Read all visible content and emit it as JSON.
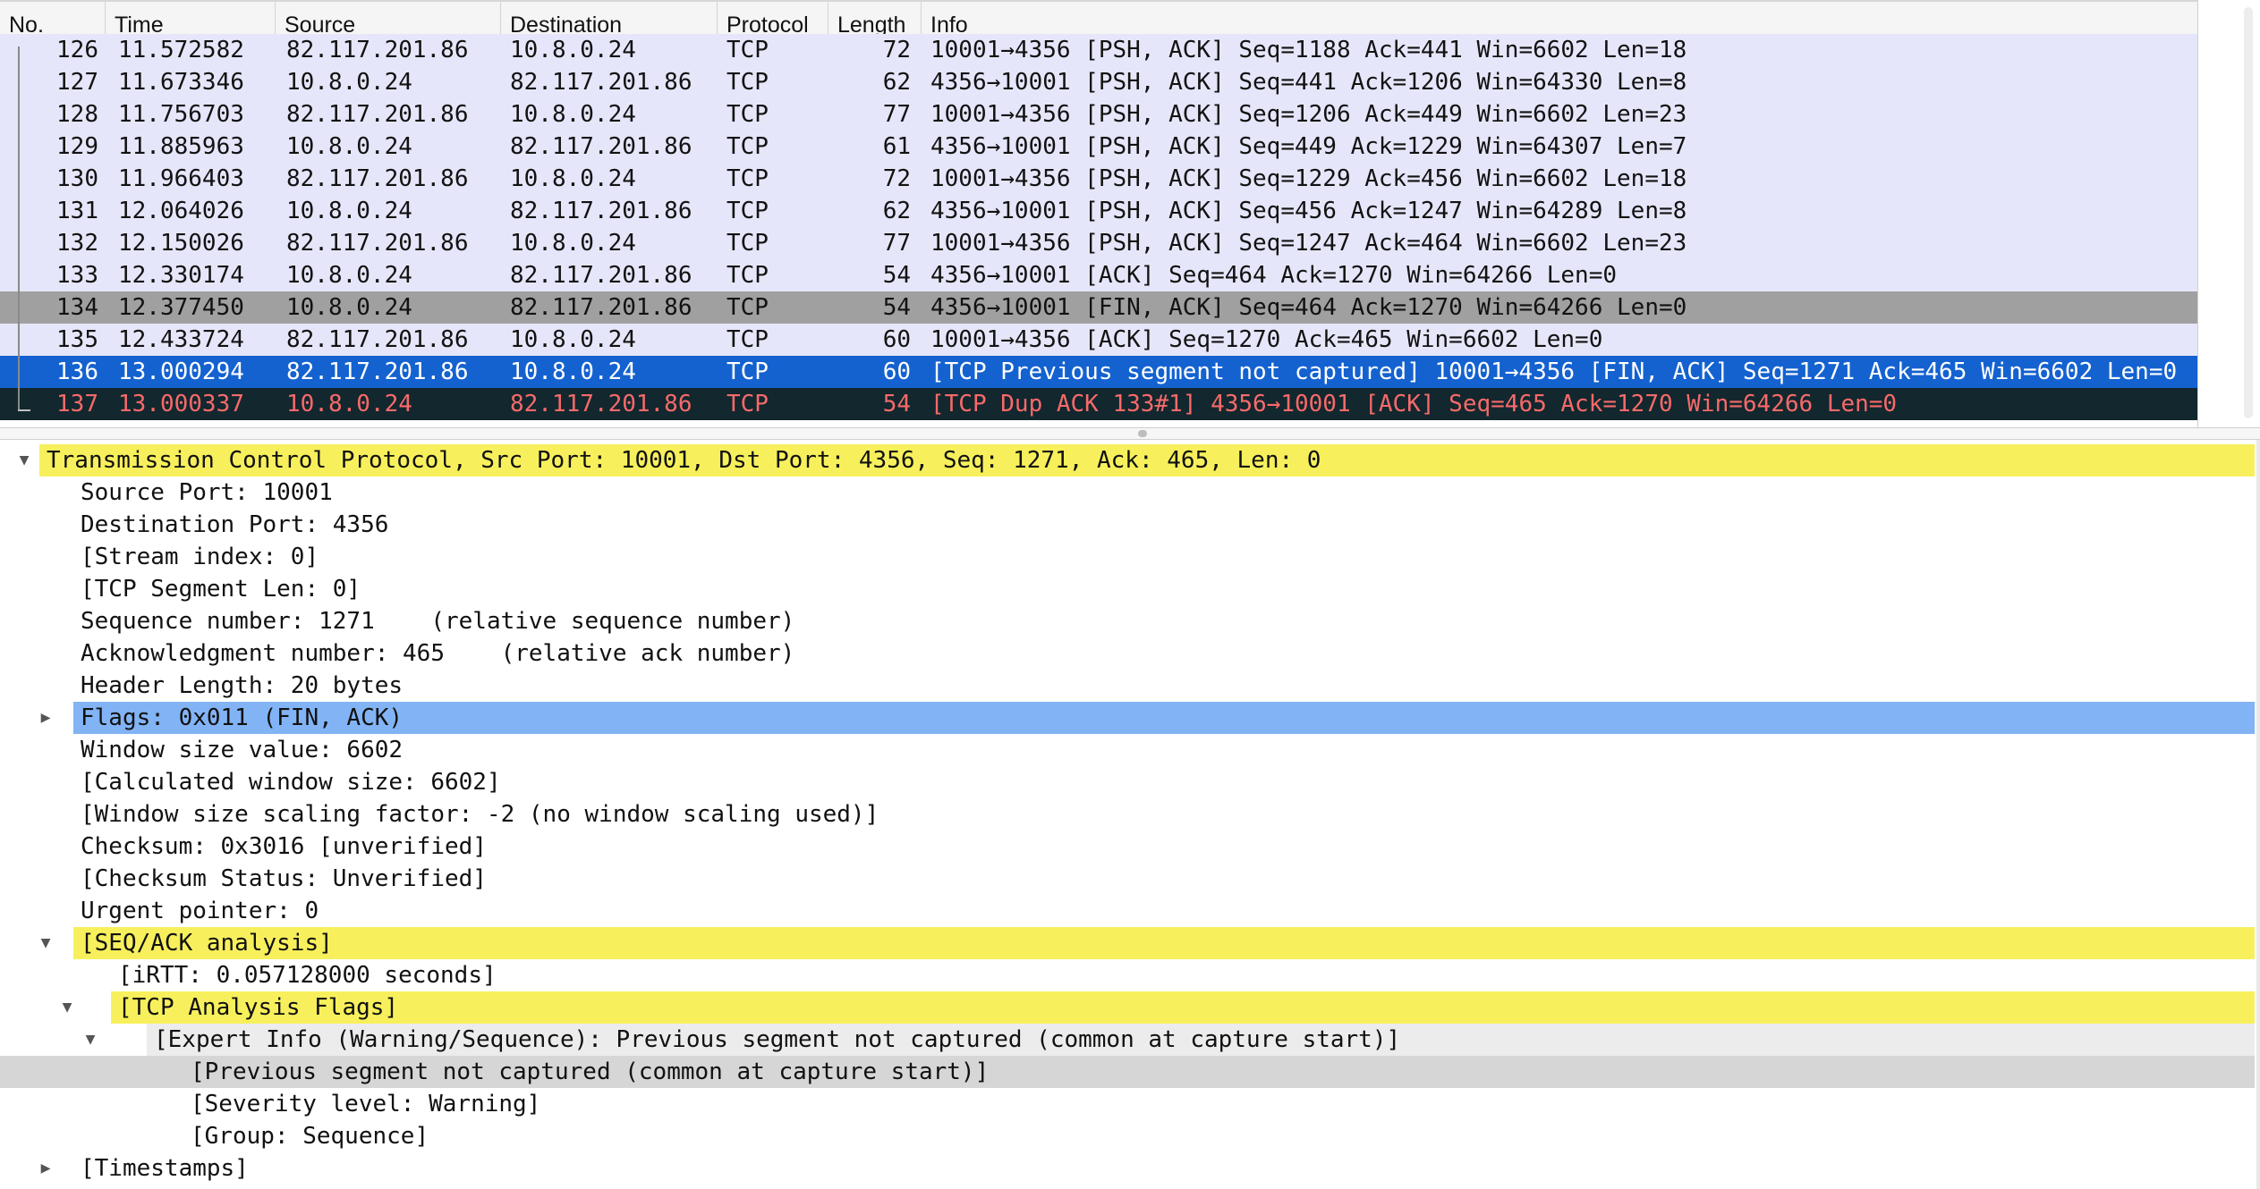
{
  "columns": {
    "no": "No.",
    "time": "Time",
    "source": "Source",
    "destination": "Destination",
    "protocol": "Protocol",
    "length": "Length",
    "info": "Info"
  },
  "colors": {
    "row_default": "#e6e6fa",
    "row_marked": "#a0a0a0",
    "row_selected": "#1462d0",
    "row_error_bg": "#12272e",
    "row_error_fg": "#f76a6a",
    "highlight_yellow": "#f7f05c",
    "highlight_flags": "#82b4f5",
    "expert_gray": "#ececec",
    "expert_selected_gray": "#d6d6d6"
  },
  "packets": [
    {
      "no": "126",
      "time": "11.572582",
      "src": "82.117.201.86",
      "dst": "10.8.0.24",
      "proto": "TCP",
      "len": "72",
      "info": "10001→4356 [PSH, ACK] Seq=1188 Ack=441 Win=6602 Len=18",
      "style": "normal"
    },
    {
      "no": "127",
      "time": "11.673346",
      "src": "10.8.0.24",
      "dst": "82.117.201.86",
      "proto": "TCP",
      "len": "62",
      "info": "4356→10001 [PSH, ACK] Seq=441 Ack=1206 Win=64330 Len=8",
      "style": "normal"
    },
    {
      "no": "128",
      "time": "11.756703",
      "src": "82.117.201.86",
      "dst": "10.8.0.24",
      "proto": "TCP",
      "len": "77",
      "info": "10001→4356 [PSH, ACK] Seq=1206 Ack=449 Win=6602 Len=23",
      "style": "normal"
    },
    {
      "no": "129",
      "time": "11.885963",
      "src": "10.8.0.24",
      "dst": "82.117.201.86",
      "proto": "TCP",
      "len": "61",
      "info": "4356→10001 [PSH, ACK] Seq=449 Ack=1229 Win=64307 Len=7",
      "style": "normal"
    },
    {
      "no": "130",
      "time": "11.966403",
      "src": "82.117.201.86",
      "dst": "10.8.0.24",
      "proto": "TCP",
      "len": "72",
      "info": "10001→4356 [PSH, ACK] Seq=1229 Ack=456 Win=6602 Len=18",
      "style": "normal"
    },
    {
      "no": "131",
      "time": "12.064026",
      "src": "10.8.0.24",
      "dst": "82.117.201.86",
      "proto": "TCP",
      "len": "62",
      "info": "4356→10001 [PSH, ACK] Seq=456 Ack=1247 Win=64289 Len=8",
      "style": "normal"
    },
    {
      "no": "132",
      "time": "12.150026",
      "src": "82.117.201.86",
      "dst": "10.8.0.24",
      "proto": "TCP",
      "len": "77",
      "info": "10001→4356 [PSH, ACK] Seq=1247 Ack=464 Win=6602 Len=23",
      "style": "normal"
    },
    {
      "no": "133",
      "time": "12.330174",
      "src": "10.8.0.24",
      "dst": "82.117.201.86",
      "proto": "TCP",
      "len": "54",
      "info": "4356→10001 [ACK] Seq=464 Ack=1270 Win=64266 Len=0",
      "style": "normal"
    },
    {
      "no": "134",
      "time": "12.377450",
      "src": "10.8.0.24",
      "dst": "82.117.201.86",
      "proto": "TCP",
      "len": "54",
      "info": "4356→10001 [FIN, ACK] Seq=464 Ack=1270 Win=64266 Len=0",
      "style": "marked"
    },
    {
      "no": "135",
      "time": "12.433724",
      "src": "82.117.201.86",
      "dst": "10.8.0.24",
      "proto": "TCP",
      "len": "60",
      "info": "10001→4356 [ACK] Seq=1270 Ack=465 Win=6602 Len=0",
      "style": "normal"
    },
    {
      "no": "136",
      "time": "13.000294",
      "src": "82.117.201.86",
      "dst": "10.8.0.24",
      "proto": "TCP",
      "len": "60",
      "info": "[TCP Previous segment not captured] 10001→4356 [FIN, ACK] Seq=1271 Ack=465 Win=6602 Len=0",
      "style": "selected"
    },
    {
      "no": "137",
      "time": "13.000337",
      "src": "10.8.0.24",
      "dst": "82.117.201.86",
      "proto": "TCP",
      "len": "54",
      "info": "[TCP Dup ACK 133#1] 4356→10001 [ACK] Seq=465 Ack=1270 Win=64266 Len=0",
      "style": "error"
    }
  ],
  "details": [
    {
      "text": "Transmission Control Protocol, Src Port: 10001, Dst Port: 4356, Seq: 1271, Ack: 465, Len: 0",
      "level": 0,
      "arrow": "expanded",
      "style": "yellow",
      "name": "tree-tcp-header"
    },
    {
      "text": "Source Port: 10001",
      "level": 1,
      "arrow": "none",
      "style": "none",
      "name": "tree-source-port"
    },
    {
      "text": "Destination Port: 4356",
      "level": 1,
      "arrow": "none",
      "style": "none",
      "name": "tree-destination-port"
    },
    {
      "text": "[Stream index: 0]",
      "level": 1,
      "arrow": "none",
      "style": "none",
      "name": "tree-stream-index"
    },
    {
      "text": "[TCP Segment Len: 0]",
      "level": 1,
      "arrow": "none",
      "style": "none",
      "name": "tree-segment-len"
    },
    {
      "text": "Sequence number: 1271    (relative sequence number)",
      "level": 1,
      "arrow": "none",
      "style": "none",
      "name": "tree-sequence-number"
    },
    {
      "text": "Acknowledgment number: 465    (relative ack number)",
      "level": 1,
      "arrow": "none",
      "style": "none",
      "name": "tree-ack-number"
    },
    {
      "text": "Header Length: 20 bytes",
      "level": 1,
      "arrow": "none",
      "style": "none",
      "name": "tree-header-length"
    },
    {
      "text": "Flags: 0x011 (FIN, ACK)",
      "level": 1,
      "arrow": "collapsed",
      "style": "blue",
      "name": "tree-flags"
    },
    {
      "text": "Window size value: 6602",
      "level": 1,
      "arrow": "none",
      "style": "none",
      "name": "tree-window-size"
    },
    {
      "text": "[Calculated window size: 6602]",
      "level": 1,
      "arrow": "none",
      "style": "none",
      "name": "tree-calculated-window"
    },
    {
      "text": "[Window size scaling factor: -2 (no window scaling used)]",
      "level": 1,
      "arrow": "none",
      "style": "none",
      "name": "tree-window-scaling"
    },
    {
      "text": "Checksum: 0x3016 [unverified]",
      "level": 1,
      "arrow": "none",
      "style": "none",
      "name": "tree-checksum"
    },
    {
      "text": "[Checksum Status: Unverified]",
      "level": 1,
      "arrow": "none",
      "style": "none",
      "name": "tree-checksum-status"
    },
    {
      "text": "Urgent pointer: 0",
      "level": 1,
      "arrow": "none",
      "style": "none",
      "name": "tree-urgent-pointer"
    },
    {
      "text": "[SEQ/ACK analysis]",
      "level": 1,
      "arrow": "expanded",
      "style": "yellow",
      "name": "tree-seq-ack-analysis"
    },
    {
      "text": "[iRTT: 0.057128000 seconds]",
      "level": 2,
      "arrow": "none",
      "style": "none",
      "name": "tree-irtt"
    },
    {
      "text": "[TCP Analysis Flags]",
      "level": 2,
      "arrow": "expanded",
      "style": "yellow",
      "name": "tree-analysis-flags"
    },
    {
      "text": "[Expert Info (Warning/Sequence): Previous segment not captured (common at capture start)]",
      "level": 3,
      "arrow": "expanded",
      "style": "gray",
      "name": "tree-expert-info"
    },
    {
      "text": "[Previous segment not captured (common at capture start)]",
      "level": 4,
      "arrow": "none",
      "style": "grayfull",
      "name": "tree-previous-segment"
    },
    {
      "text": "[Severity level: Warning]",
      "level": 4,
      "arrow": "none",
      "style": "none",
      "name": "tree-severity-level"
    },
    {
      "text": "[Group: Sequence]",
      "level": 4,
      "arrow": "none",
      "style": "none",
      "name": "tree-group"
    },
    {
      "text": "[Timestamps]",
      "level": 1,
      "arrow": "collapsed",
      "style": "none",
      "name": "tree-timestamps"
    }
  ]
}
